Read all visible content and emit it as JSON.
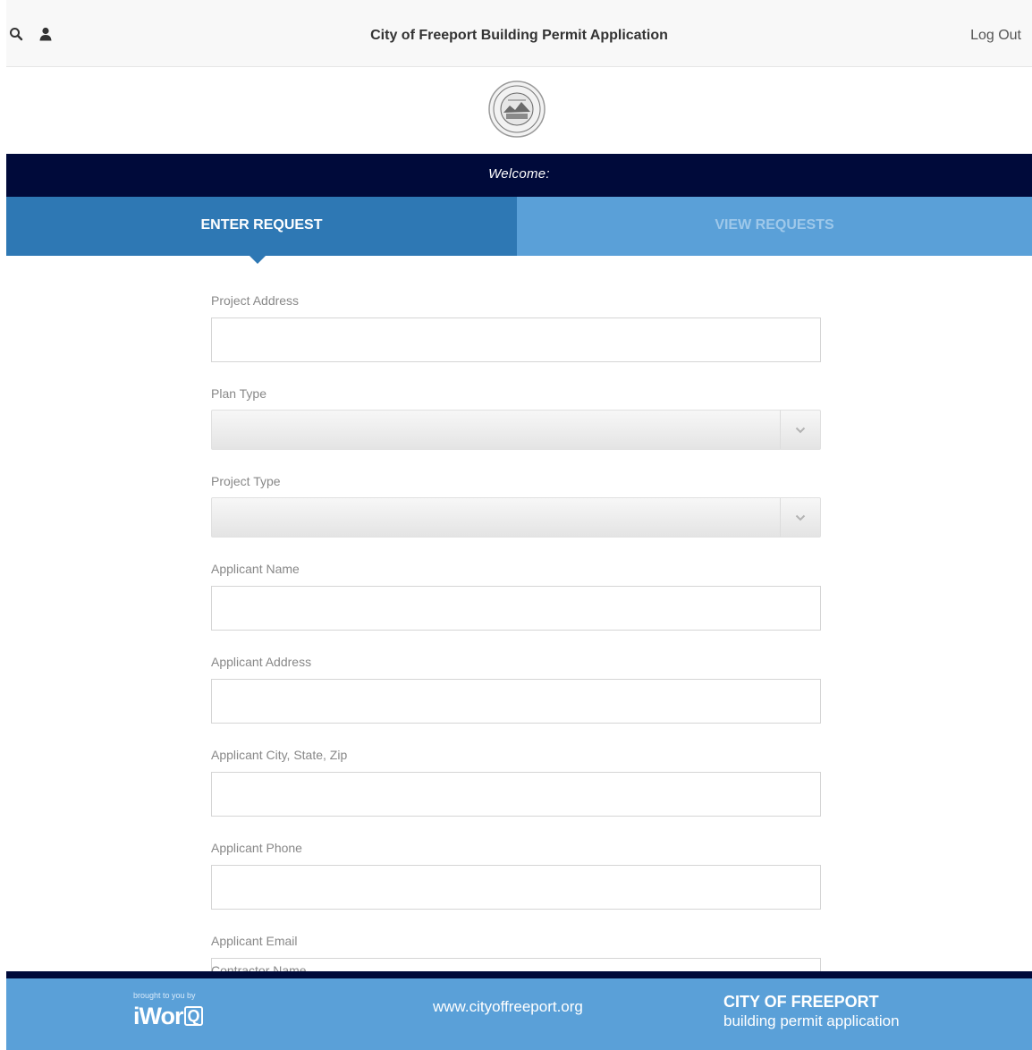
{
  "header": {
    "title": "City of Freeport Building Permit Application",
    "logout_label": "Log Out",
    "icons": [
      "search-icon",
      "user-icon"
    ]
  },
  "welcome": {
    "text": "Welcome:"
  },
  "tabs": [
    {
      "label": "ENTER REQUEST",
      "active": true
    },
    {
      "label": "VIEW REQUESTS",
      "active": false
    }
  ],
  "form": {
    "project_address": {
      "label": "Project Address",
      "value": "",
      "placeholder": ""
    },
    "plan_type": {
      "label": "Plan Type",
      "selected": ""
    },
    "project_type": {
      "label": "Project Type",
      "selected": ""
    },
    "applicant_name": {
      "label": "Applicant Name",
      "value": "",
      "placeholder": ""
    },
    "applicant_address": {
      "label": "Applicant Address",
      "value": "",
      "placeholder": ""
    },
    "applicant_city": {
      "label": "Applicant City, State, Zip",
      "value": "",
      "placeholder": ""
    },
    "applicant_phone": {
      "label": "Applicant Phone",
      "value": "",
      "placeholder": ""
    },
    "applicant_email": {
      "label": "Applicant Email",
      "value": "",
      "placeholder": ""
    },
    "contractor_name": {
      "label": "Contractor Name"
    }
  },
  "footer": {
    "brought_by": "brought to you by",
    "brand": "iWor",
    "brand_q": "Q",
    "website": "www.cityoffreeport.org",
    "city_name": "CITY OF FREEPORT",
    "city_sub": "building permit application"
  },
  "colors": {
    "navy": "#000a3a",
    "tab_active": "#2e78b4",
    "tab_inactive": "#5aa0d8",
    "footer": "#5aa0d8"
  }
}
